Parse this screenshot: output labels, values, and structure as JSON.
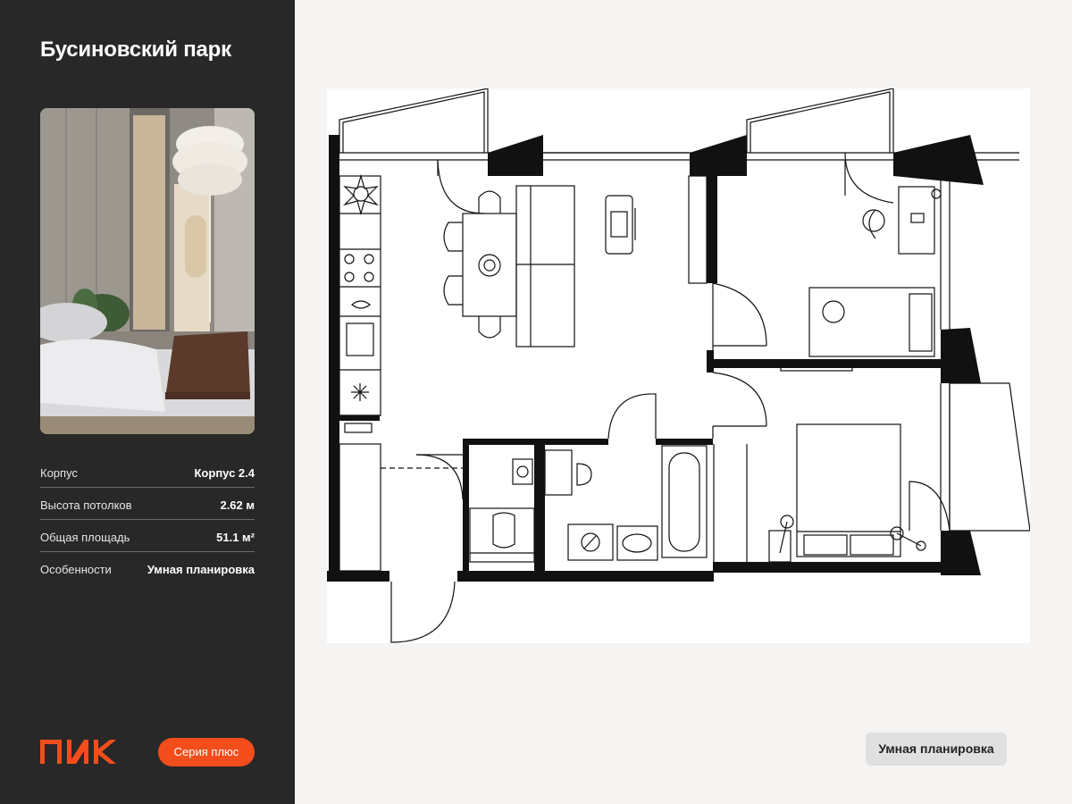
{
  "project": {
    "title": "Бусиновский парк"
  },
  "photo": {
    "subject": "bedroom-interior-photo"
  },
  "specs": [
    {
      "label": "Корпус",
      "value": "Корпус 2.4"
    },
    {
      "label": "Высота потолков",
      "value": "2.62 м"
    },
    {
      "label": "Общая площадь",
      "value": "51.1 м²"
    },
    {
      "label": "Особенности",
      "value": "Умная планировка"
    }
  ],
  "brand": {
    "logo_text": "ПИК",
    "color": "#f44d1c"
  },
  "series_badge": "Серия плюс",
  "feature_tag": "Умная планировка",
  "colors": {
    "sidebar_bg": "#282828",
    "page_bg": "#f5f4f2",
    "accent": "#f44d1c",
    "tag_bg": "#e0e0e0"
  }
}
